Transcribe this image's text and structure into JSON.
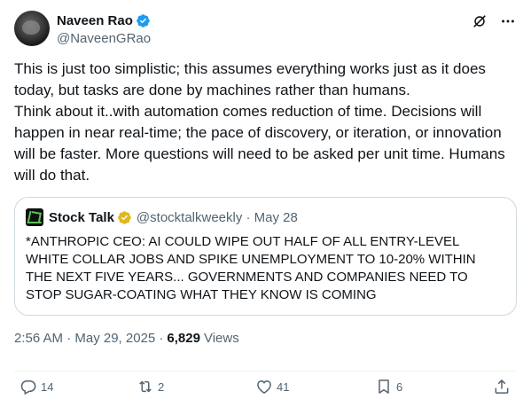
{
  "author": {
    "name": "Naveen Rao",
    "handle": "@NaveenGRao"
  },
  "tweet": {
    "lines": [
      "This is just too simplistic; this assumes everything works just as it does today, but tasks are done by machines rather than humans.",
      "Think about it..with automation comes reduction of time. Decisions will happen in near real-time; the pace of discovery, or iteration, or innovation will be faster. More questions will need to be asked per unit time. Humans will do that."
    ]
  },
  "quote": {
    "name": "Stock Talk",
    "handle_date": "@stocktalkweekly · May 28",
    "text": "*ANTHROPIC CEO: AI COULD WIPE OUT HALF OF ALL ENTRY-LEVEL WHITE COLLAR JOBS AND SPIKE UNEMPLOYMENT TO 10-20% WITHIN THE NEXT FIVE YEARS... GOVERNMENTS AND COMPANIES NEED TO STOP SUGAR-COATING WHAT THEY KNOW IS COMING"
  },
  "meta": {
    "timestamp": "2:56 AM · May 29, 2025 ·",
    "views_count": "6,829",
    "views_label": "Views"
  },
  "actions": {
    "replies": "14",
    "reposts": "2",
    "likes": "41",
    "bookmarks": "6"
  },
  "colors": {
    "verified": "#1d9bf0",
    "secondary_text": "#536471",
    "primary_text": "#0f1419",
    "border": "#cfd9de",
    "gold_badge": "#e2b719"
  },
  "icons": {
    "verified": "verified-badge-icon",
    "grok": "grok-icon",
    "more": "more-icon",
    "reply": "reply-icon",
    "repost": "repost-icon",
    "like": "like-icon",
    "bookmark": "bookmark-icon",
    "share": "share-icon"
  }
}
